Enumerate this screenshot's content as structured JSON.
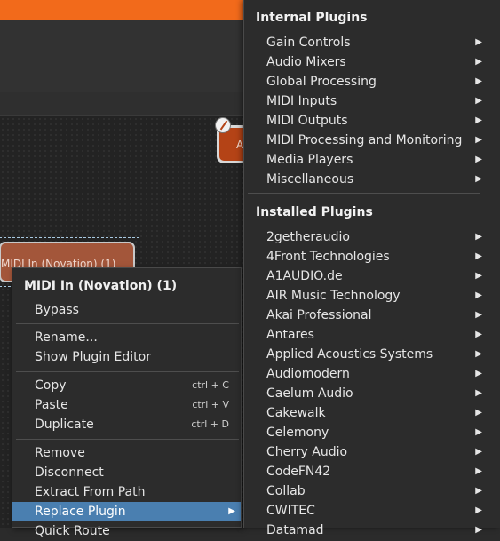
{
  "context_menu": {
    "title": "MIDI In (Novation) (1)",
    "items": [
      {
        "label": "Bypass",
        "shortcut": ""
      },
      {
        "label": "Rename...",
        "shortcut": ""
      },
      {
        "label": "Show Plugin Editor",
        "shortcut": ""
      },
      {
        "label": "Copy",
        "shortcut": "ctrl + C"
      },
      {
        "label": "Paste",
        "shortcut": "ctrl + V"
      },
      {
        "label": "Duplicate",
        "shortcut": "ctrl + D"
      },
      {
        "label": "Remove",
        "shortcut": ""
      },
      {
        "label": "Disconnect",
        "shortcut": ""
      },
      {
        "label": "Extract From Path",
        "shortcut": ""
      },
      {
        "label": "Replace Plugin",
        "shortcut": ""
      },
      {
        "label": "Quick Route",
        "shortcut": ""
      }
    ],
    "submenu_arrow": "▶"
  },
  "node": {
    "midi_label": "MIDI In (Novation) (1)",
    "a_label": "A"
  },
  "plugin_menu": {
    "internal_header": "Internal Plugins",
    "internal": [
      "Gain Controls",
      "Audio Mixers",
      "Global Processing",
      "MIDI Inputs",
      "MIDI Outputs",
      "MIDI Processing and Monitoring",
      "Media Players",
      "Miscellaneous"
    ],
    "installed_header": "Installed Plugins",
    "installed": [
      "2getheraudio",
      "4Front Technologies",
      "A1AUDIO.de",
      "AIR Music Technology",
      "Akai Professional",
      "Antares",
      "Applied Acoustics Systems",
      "Audiomodern",
      "Caelum Audio",
      "Cakewalk",
      "Celemony",
      "Cherry Audio",
      "CodeFN42",
      "Collab",
      "CWITEC",
      "Datamad"
    ],
    "arrow": "▶"
  },
  "colors": {
    "accent": "#f26a1b",
    "highlight": "#4a7fb0",
    "menu_bg": "#2c2c2c",
    "node": "#a3563a"
  }
}
